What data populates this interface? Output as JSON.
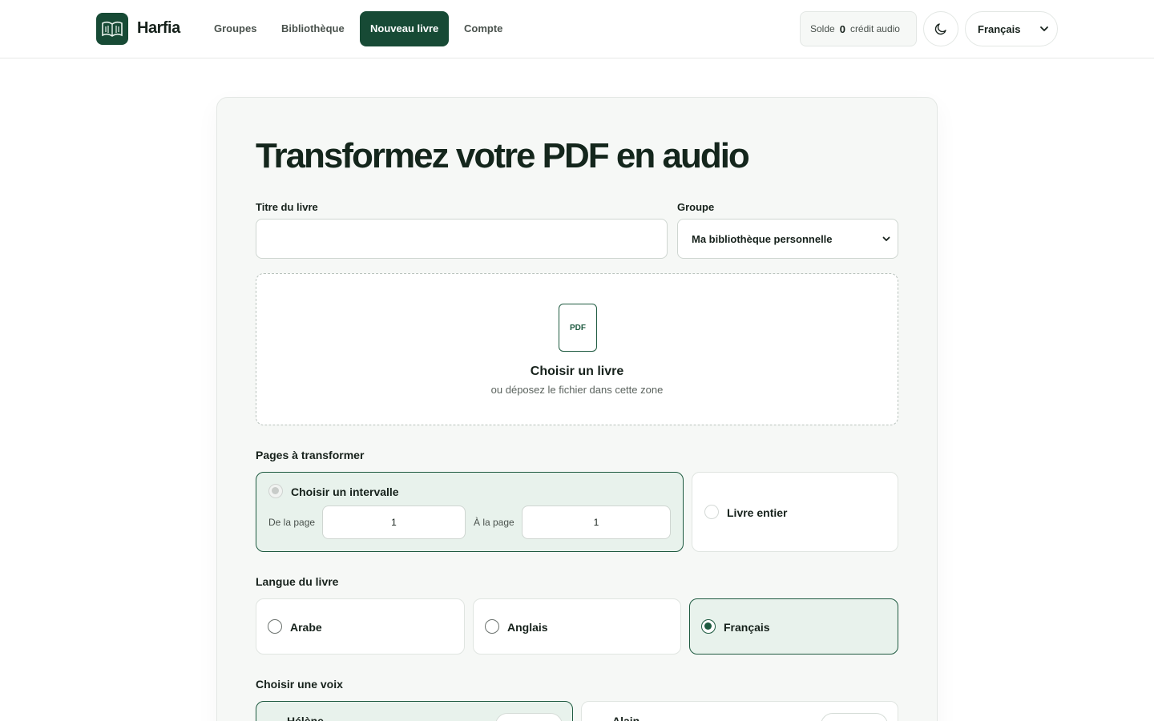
{
  "header": {
    "brand": "Harfia",
    "nav": [
      {
        "label": "Groupes",
        "active": false
      },
      {
        "label": "Bibliothèque",
        "active": false
      },
      {
        "label": "Nouveau livre",
        "active": true
      },
      {
        "label": "Compte",
        "active": false
      }
    ],
    "balance": {
      "prefix": "Solde",
      "value": "0",
      "suffix": "crédit audio"
    },
    "language": "Français"
  },
  "form": {
    "title": "Transformez votre PDF en audio",
    "book_title_label": "Titre du livre",
    "book_title_value": "",
    "group_label": "Groupe",
    "group_value": "Ma bibliothèque personnelle",
    "dropzone": {
      "icon_text": "PDF",
      "title": "Choisir un livre",
      "subtitle": "ou déposez le fichier dans cette zone"
    },
    "pages": {
      "label": "Pages à transformer",
      "range_option": "Choisir un intervalle",
      "from_label": "De la page",
      "from_value": "1",
      "to_label": "À la page",
      "to_value": "1",
      "whole_option": "Livre entier"
    },
    "language": {
      "label": "Langue du livre",
      "options": [
        "Arabe",
        "Anglais",
        "Français"
      ],
      "selected": "Français"
    },
    "voice": {
      "label": "Choisir une voix",
      "options": [
        "Hélène",
        "Alain"
      ]
    }
  },
  "colors": {
    "brand": "#174a35",
    "accent": "#1e5a40",
    "selected_bg": "#e8f2ec"
  }
}
